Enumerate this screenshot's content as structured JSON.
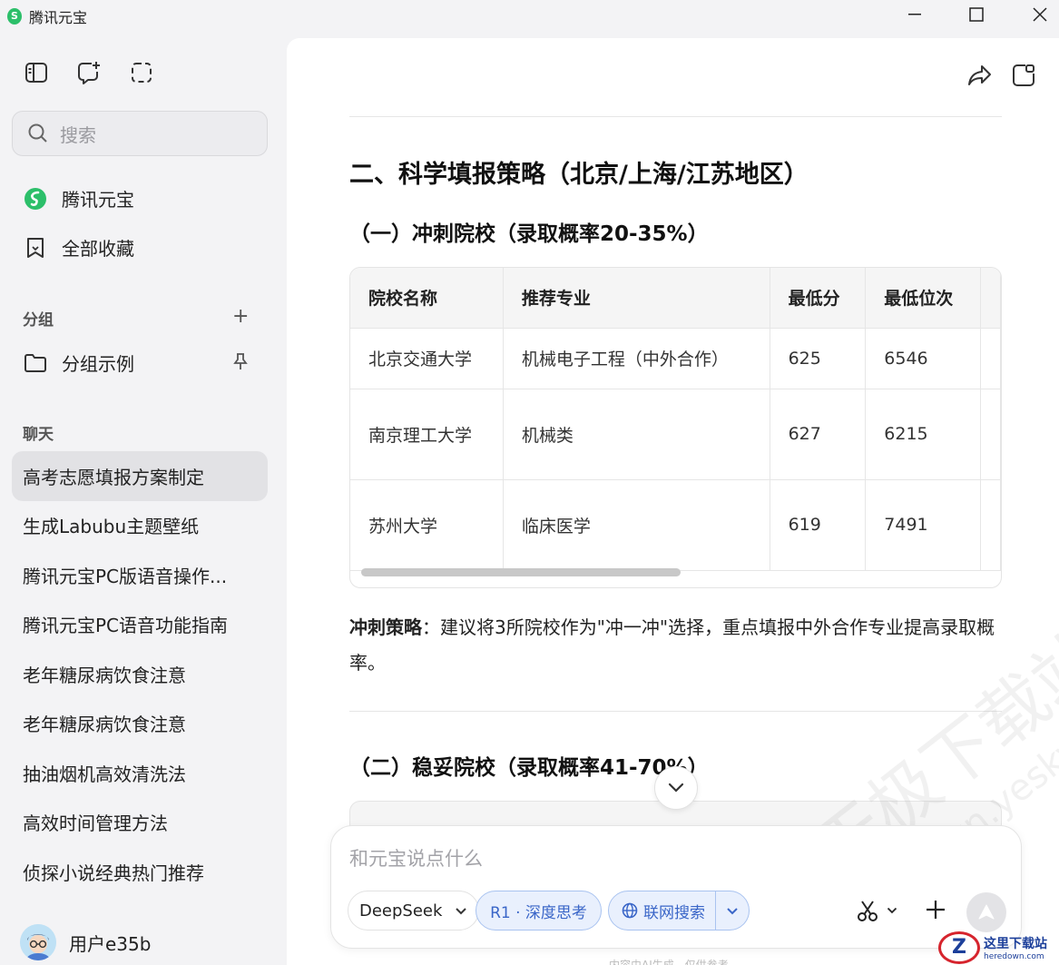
{
  "app": {
    "title": "腾讯元宝",
    "logo_glyph": "S"
  },
  "window": {
    "minimize": "—",
    "maximize": "☐",
    "close": "✕"
  },
  "sidebar": {
    "search_placeholder": "搜索",
    "nav": [
      {
        "label": "腾讯元宝",
        "icon": "yuanbao-logo-icon"
      },
      {
        "label": "全部收藏",
        "icon": "bookmark-icon"
      }
    ],
    "groups_label": "分组",
    "group_add": "+",
    "group_items": [
      {
        "label": "分组示例",
        "icon": "folder-icon"
      }
    ],
    "chats_label": "聊天",
    "chats": [
      "高考志愿填报方案制定",
      "生成Labubu主题壁纸",
      "腾讯元宝PC版语音操作...",
      "腾讯元宝PC语音功能指南",
      "老年糖尿病饮食注意",
      "老年糖尿病饮食注意",
      "抽油烟机高效清洗法",
      "高效时间管理方法",
      "侦探小说经典热门推荐"
    ],
    "active_chat_index": 0,
    "user_name": "用户e35b"
  },
  "content": {
    "heading": "二、科学填报策略（北京/上海/江苏地区）",
    "sub1": "（一）冲刺院校（录取概率20-35%）",
    "table": {
      "headers": [
        "院校名称",
        "推荐专业",
        "最低分",
        "最低位次"
      ],
      "rows": [
        [
          "北京交通大学",
          "机械电子工程（中外合作）",
          "625",
          "6546"
        ],
        [
          "南京理工大学",
          "机械类",
          "627",
          "6215"
        ],
        [
          "苏州大学",
          "临床医学",
          "619",
          "7491"
        ]
      ]
    },
    "strategy_label": "冲刺策略",
    "strategy_text": "：建议将3所院校作为\"冲一冲\"选择，重点填报中外合作专业提高录取概率。",
    "sub2": "（二）稳妥院校（录取概率41-70%）"
  },
  "composer": {
    "placeholder": "和元宝说点什么",
    "model": "DeepSeek",
    "r1_label": "R1 · 深度思考",
    "web_label": "联网搜索",
    "disclaimer": "内容由AI生成，仅供参考"
  },
  "watermark": {
    "main": "天极下载站",
    "sub": "mydown.yesky.com"
  },
  "corner_logo": {
    "glyph": "Z",
    "title": "这里下载站",
    "url": "heredown.com"
  },
  "colors": {
    "accent": "#3a66c8",
    "pill_bg": "#e9f0fd",
    "logo_green": "#2cbf6a"
  }
}
